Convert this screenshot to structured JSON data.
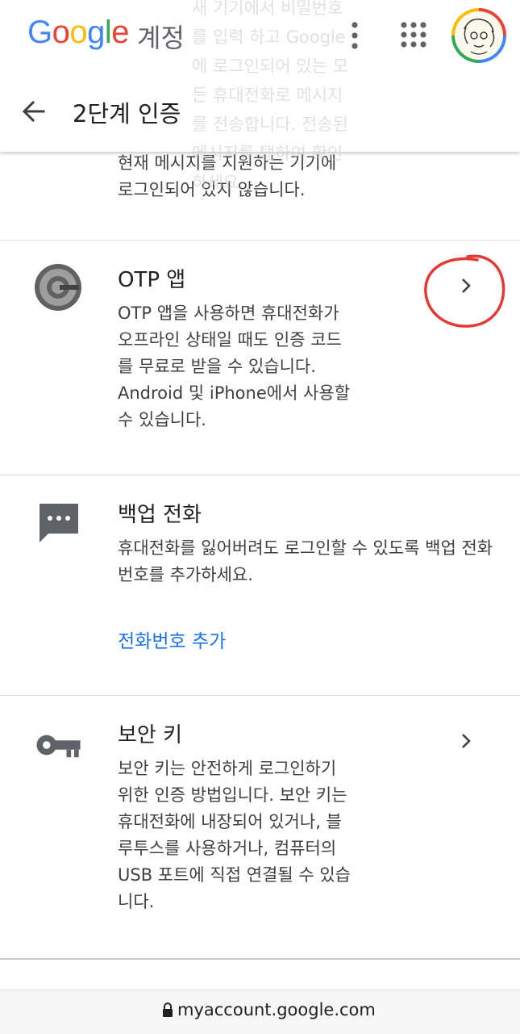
{
  "header": {
    "logo_text": "Google",
    "account_label": "계정",
    "page_title": "2단계 인증",
    "ghost_text": "새 기기에서 비밀번호를 입력 하고 Google에 로그인되어 있는 모든 휴대전화로 메시지를 전송합니다. 전송된 메시지를 탭하여 확인하세요."
  },
  "sections": {
    "prompt_tail": "현재 메시지를 지원하는 기기에 로그인되어 있지 않습니다.",
    "otp": {
      "title": "OTP 앱",
      "description": "OTP 앱을 사용하면 휴대전화가 오프라인 상태일 때도 인증 코드를 무료로 받을 수 있습니다. Android 및 iPhone에서 사용할 수 있습니다."
    },
    "backup": {
      "title": "백업 전화",
      "description": "휴대전화를 잃어버려도 로그인할 수 있도록 백업 전화번호를 추가하세요.",
      "link": "전화번호 추가"
    },
    "security_key": {
      "title": "보안 키",
      "description": "보안 키는 안전하게 로그인하기 위한 인증 방법입니다. 보안 키는 휴대전화에 내장되어 있거나, 블루투스를 사용하거나, 컴퓨터의 USB 포트에 직접 연결될 수 있습니다."
    }
  },
  "browser": {
    "url": "myaccount.google.com"
  },
  "icons": {
    "back": "back-arrow-icon",
    "menu": "more-vert-icon",
    "apps": "apps-grid-icon",
    "authenticator": "google-authenticator-icon",
    "message": "message-icon",
    "key": "key-icon",
    "chevron": "chevron-right-icon",
    "lock": "lock-icon"
  },
  "colors": {
    "google_blue": "#4285F4",
    "google_red": "#EA4335",
    "google_yellow": "#FBBC05",
    "google_green": "#34A853",
    "link": "#1a73e8",
    "annotation": "#e53935",
    "icon_gray": "#5f6368"
  }
}
